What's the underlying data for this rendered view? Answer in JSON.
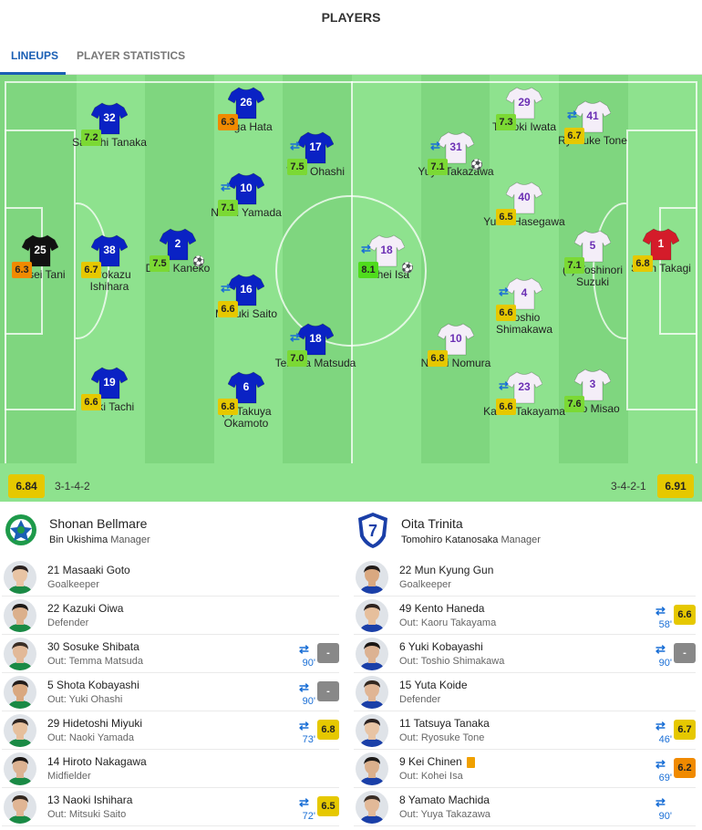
{
  "header": {
    "title": "PLAYERS"
  },
  "tabs": [
    {
      "label": "LINEUPS"
    },
    {
      "label": "PLAYER STATISTICS"
    }
  ],
  "colors": {
    "accent": "#1a5fb4",
    "home_shirt": "#0a22c4",
    "away_shirt": "#f4eef8",
    "home_gk": "#111111",
    "away_gk": "#d41c2a",
    "rating_green": "#7bd934",
    "rating_yellow": "#e6c800",
    "rating_orange": "#f08a00",
    "rating_grey": "#888888"
  },
  "home": {
    "name": "Shonan Bellmare",
    "manager": "Bin Ukishima",
    "manager_label": "Manager",
    "formation": "3-1-4-2",
    "team_rating": "6.84",
    "lineup": [
      {
        "num": "25",
        "name": "Kosei Tani",
        "rating": "6.3",
        "rating_color": "orange",
        "gk": true
      },
      {
        "num": "32",
        "name": "Satoshi Tanaka",
        "rating": "7.2",
        "rating_color": "green"
      },
      {
        "num": "38",
        "name": "Hirokazu Ishihara",
        "rating": "6.7",
        "rating_color": "yellow"
      },
      {
        "num": "19",
        "name": "Koki Tachi",
        "rating": "6.6",
        "rating_color": "yellow"
      },
      {
        "num": "2",
        "name": "Daiki Kaneko",
        "rating": "7.5",
        "rating_color": "green",
        "goal": true
      },
      {
        "num": "26",
        "name": "Taiga Hata",
        "rating": "6.3",
        "rating_color": "orange"
      },
      {
        "num": "10",
        "name": "Naoki Yamada",
        "rating": "7.1",
        "rating_color": "green",
        "sub": true
      },
      {
        "num": "16",
        "name": "Mitsuki Saito",
        "rating": "6.6",
        "rating_color": "yellow",
        "sub": true
      },
      {
        "num": "6",
        "name": "(c) Takuya Okamoto",
        "rating": "6.8",
        "rating_color": "yellow"
      },
      {
        "num": "17",
        "name": "Yuki Ohashi",
        "rating": "7.5",
        "rating_color": "green",
        "sub": true
      },
      {
        "num": "18",
        "name": "Temma Matsuda",
        "rating": "7.0",
        "rating_color": "green",
        "sub": true
      }
    ],
    "bench": [
      {
        "title": "21  Masaaki Goto",
        "sub": "Goalkeeper"
      },
      {
        "title": "22  Kazuki Oiwa",
        "sub": "Defender"
      },
      {
        "title": "30  Sosuke Shibata",
        "sub": "Out: Temma Matsuda",
        "minute": "90'",
        "rating": "-",
        "rating_color": "grey"
      },
      {
        "title": "5  Shota Kobayashi",
        "sub": "Out: Yuki Ohashi",
        "minute": "90'",
        "rating": "-",
        "rating_color": "grey"
      },
      {
        "title": "29  Hidetoshi Miyuki",
        "sub": "Out: Naoki Yamada",
        "minute": "73'",
        "rating": "6.8",
        "rating_color": "yellow"
      },
      {
        "title": "14  Hiroto Nakagawa",
        "sub": "Midfielder"
      },
      {
        "title": "13  Naoki Ishihara",
        "sub": "Out: Mitsuki Saito",
        "minute": "72'",
        "rating": "6.5",
        "rating_color": "yellow"
      }
    ]
  },
  "away": {
    "name": "Oita Trinita",
    "manager": "Tomohiro Katanosaka",
    "manager_label": "Manager",
    "formation": "3-4-2-1",
    "team_rating": "6.91",
    "lineup": [
      {
        "num": "18",
        "name": "Kohei Isa",
        "rating": "8.1",
        "rating_color": "bright",
        "sub": true,
        "goal": true
      },
      {
        "num": "31",
        "name": "Yuya Takazawa",
        "rating": "7.1",
        "rating_color": "green",
        "sub": true,
        "goal": true
      },
      {
        "num": "10",
        "name": "Naoki Nomura",
        "rating": "6.8",
        "rating_color": "yellow"
      },
      {
        "num": "29",
        "name": "Tomoki Iwata",
        "rating": "7.3",
        "rating_color": "green"
      },
      {
        "num": "40",
        "name": "Yushi Hasegawa",
        "rating": "6.5",
        "rating_color": "yellow"
      },
      {
        "num": "4",
        "name": "Toshio Shimakawa",
        "rating": "6.6",
        "rating_color": "yellow",
        "sub": true
      },
      {
        "num": "23",
        "name": "Kaoru Takayama",
        "rating": "6.6",
        "rating_color": "yellow",
        "sub": true
      },
      {
        "num": "41",
        "name": "Ryosuke Tone",
        "rating": "6.7",
        "rating_color": "yellow",
        "sub": true
      },
      {
        "num": "5",
        "name": "(c) Yoshinori Suzuki",
        "rating": "7.1",
        "rating_color": "green"
      },
      {
        "num": "3",
        "name": "Yuto Misao",
        "rating": "7.6",
        "rating_color": "green"
      },
      {
        "num": "1",
        "name": "Shun Takagi",
        "rating": "6.8",
        "rating_color": "yellow",
        "gk": true
      }
    ],
    "bench": [
      {
        "title": "22  Mun Kyung Gun",
        "sub": "Goalkeeper"
      },
      {
        "title": "49  Kento Haneda",
        "sub": "Out: Kaoru Takayama",
        "minute": "58'",
        "rating": "6.6",
        "rating_color": "yellow"
      },
      {
        "title": "6  Yuki Kobayashi",
        "sub": "Out: Toshio Shimakawa",
        "minute": "90'",
        "rating": "-",
        "rating_color": "grey"
      },
      {
        "title": "15  Yuta Koide",
        "sub": "Defender"
      },
      {
        "title": "11  Tatsuya Tanaka",
        "sub": "Out: Ryosuke Tone",
        "minute": "46'",
        "rating": "6.7",
        "rating_color": "yellow"
      },
      {
        "title": "9  Kei Chinen",
        "sub": "Out: Kohei Isa",
        "minute": "69'",
        "rating": "6.2",
        "rating_color": "orange",
        "card": "yellow-card-icon"
      },
      {
        "title": "8  Yamato Machida",
        "sub": "Out: Yuya Takazawa",
        "minute": "90'",
        "rating": "",
        "rating_color": "none"
      }
    ]
  }
}
